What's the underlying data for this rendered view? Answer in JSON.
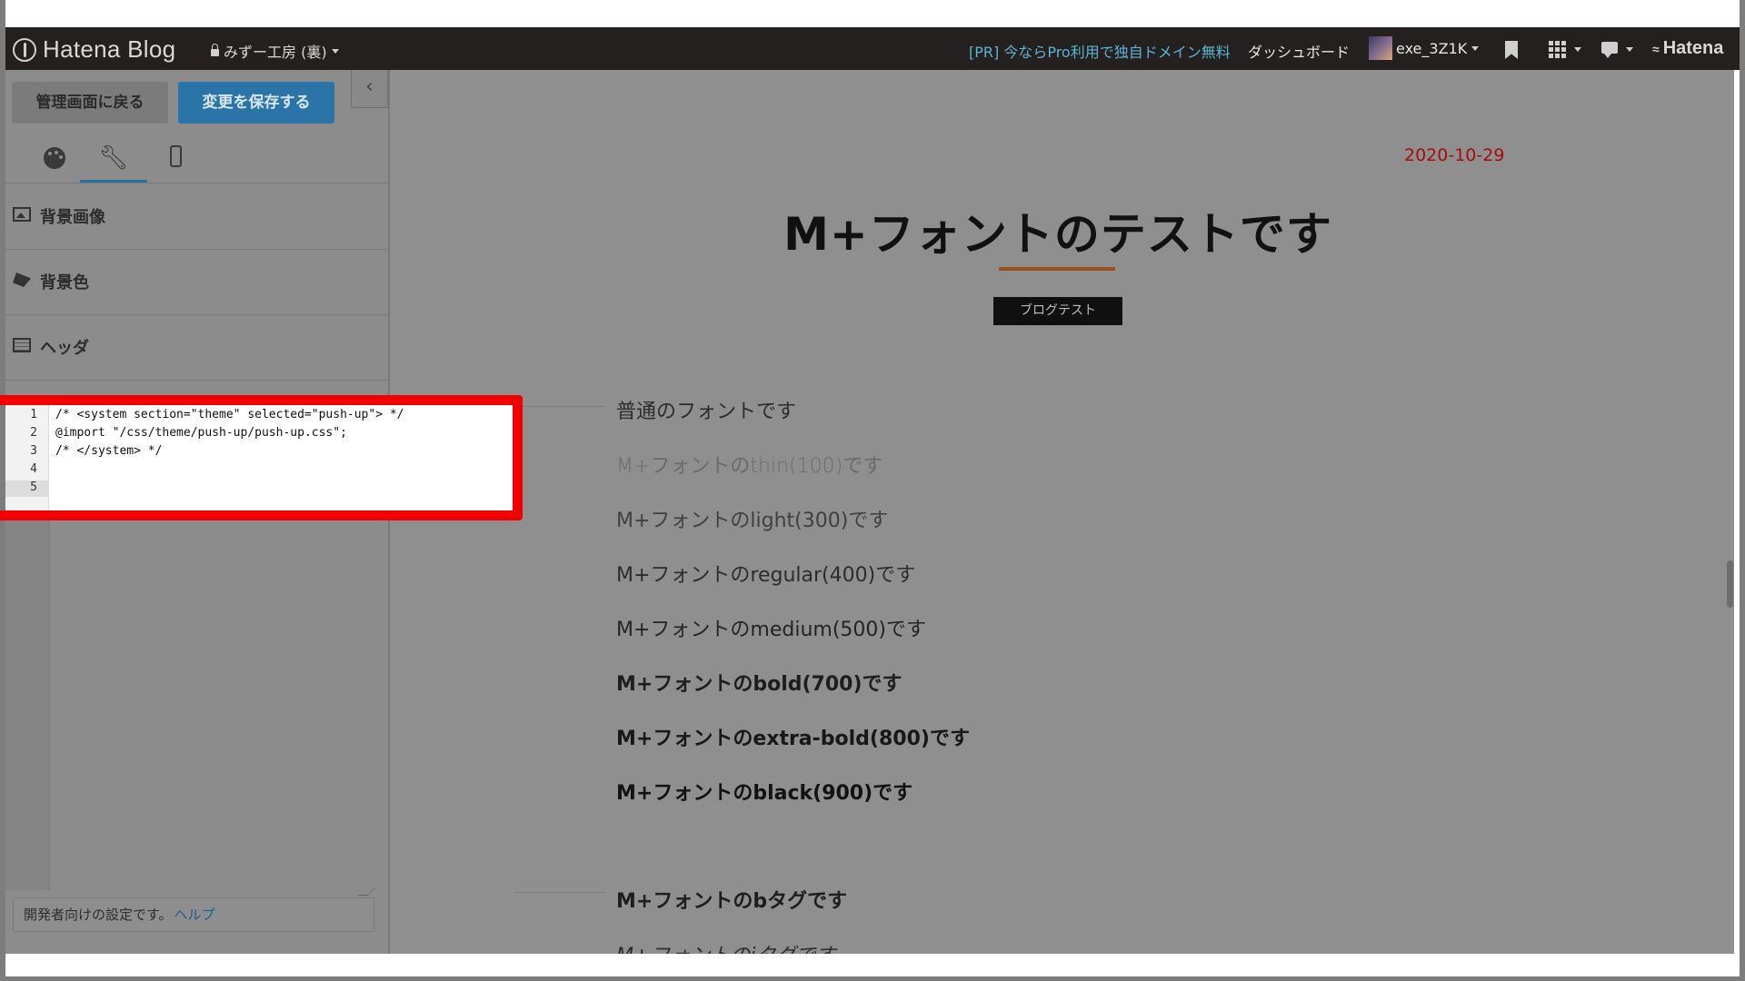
{
  "navbar": {
    "logo_text": "Hatena Blog",
    "blog_name": "みずー工房 (裏)",
    "pr_link": "[PR] 今ならPro利用で独自ドメイン無料",
    "dashboard": "ダッシュボード",
    "username": "exe_3Z1K",
    "hatena_label": "Hatena"
  },
  "sidebar": {
    "back_button": "管理画面に戻る",
    "save_button": "変更を保存する",
    "collapse_icon": "‹",
    "sections": [
      {
        "label": "背景画像",
        "icon": "image-icon"
      },
      {
        "label": "背景色",
        "icon": "paint-bucket-icon"
      },
      {
        "label": "ヘッダ",
        "icon": "header-icon"
      }
    ],
    "dev_note": "開発者向けの設定です。",
    "help_link": "ヘルプ"
  },
  "editor": {
    "line_numbers": [
      "1",
      "2",
      "3",
      "4",
      "5"
    ],
    "lines": [
      "/* <system section=\"theme\" selected=\"push-up\"> */",
      "@import \"/css/theme/push-up/push-up.css\";",
      "/* </system> */",
      "",
      ""
    ]
  },
  "preview": {
    "date": "2020-10-29",
    "title": "M+フォントのテストです",
    "category": "ブログテスト",
    "lines": [
      "普通のフォントです",
      "M+フォントのthin(100)です",
      "M+フォントのlight(300)です",
      "M+フォントのregular(400)です",
      "M+フォントのmedium(500)です",
      "M+フォントのbold(700)です",
      "M+フォントのextra-bold(800)です",
      "M+フォントのblack(900)です",
      "M+フォントのbタグです",
      "M+フォントのiタグです"
    ]
  },
  "colors": {
    "highlight": "#f20000",
    "save_button": "#2b74a7",
    "date": "#a50d0d",
    "title_underline": "#96511f"
  }
}
